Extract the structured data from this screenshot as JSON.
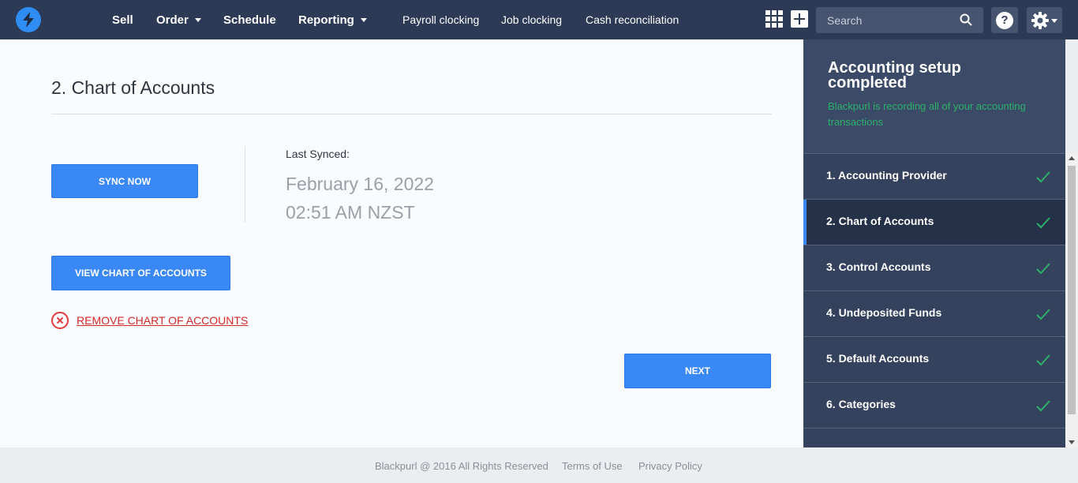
{
  "nav": {
    "items": [
      {
        "label": "Sell"
      },
      {
        "label": "Order"
      },
      {
        "label": "Schedule"
      },
      {
        "label": "Reporting"
      }
    ],
    "sub_items": [
      {
        "label": "Payroll clocking"
      },
      {
        "label": "Job clocking"
      },
      {
        "label": "Cash reconciliation"
      }
    ],
    "search_placeholder": "Search",
    "help_label": "?"
  },
  "main": {
    "title": "2. Chart of Accounts",
    "sync_button": "SYNC NOW",
    "last_synced_label": "Last Synced:",
    "last_synced_date": "February 16, 2022",
    "last_synced_time": "02:51 AM NZST",
    "view_button": "VIEW CHART OF ACCOUNTS",
    "remove_link": "REMOVE CHART OF ACCOUNTS",
    "next_button": "NEXT"
  },
  "sidebar": {
    "title": "Accounting setup completed",
    "subtitle": "Blackpurl is recording all of your accounting transactions",
    "steps": [
      {
        "label": "1. Accounting Provider",
        "completed": true
      },
      {
        "label": "2. Chart of Accounts",
        "completed": true,
        "active": true
      },
      {
        "label": "3. Control Accounts",
        "completed": true
      },
      {
        "label": "4. Undeposited Funds",
        "completed": true
      },
      {
        "label": "5. Default Accounts",
        "completed": true
      },
      {
        "label": "6. Categories",
        "completed": true
      }
    ]
  },
  "footer": {
    "copyright": "Blackpurl @ 2016 All Rights Reserved",
    "terms": "Terms of Use",
    "privacy": "Privacy Policy"
  },
  "colors": {
    "topbar": "#2c3a56",
    "accent": "#3a88f5",
    "success": "#2db06a",
    "danger": "#d62828",
    "sidebar": "#36445f"
  }
}
